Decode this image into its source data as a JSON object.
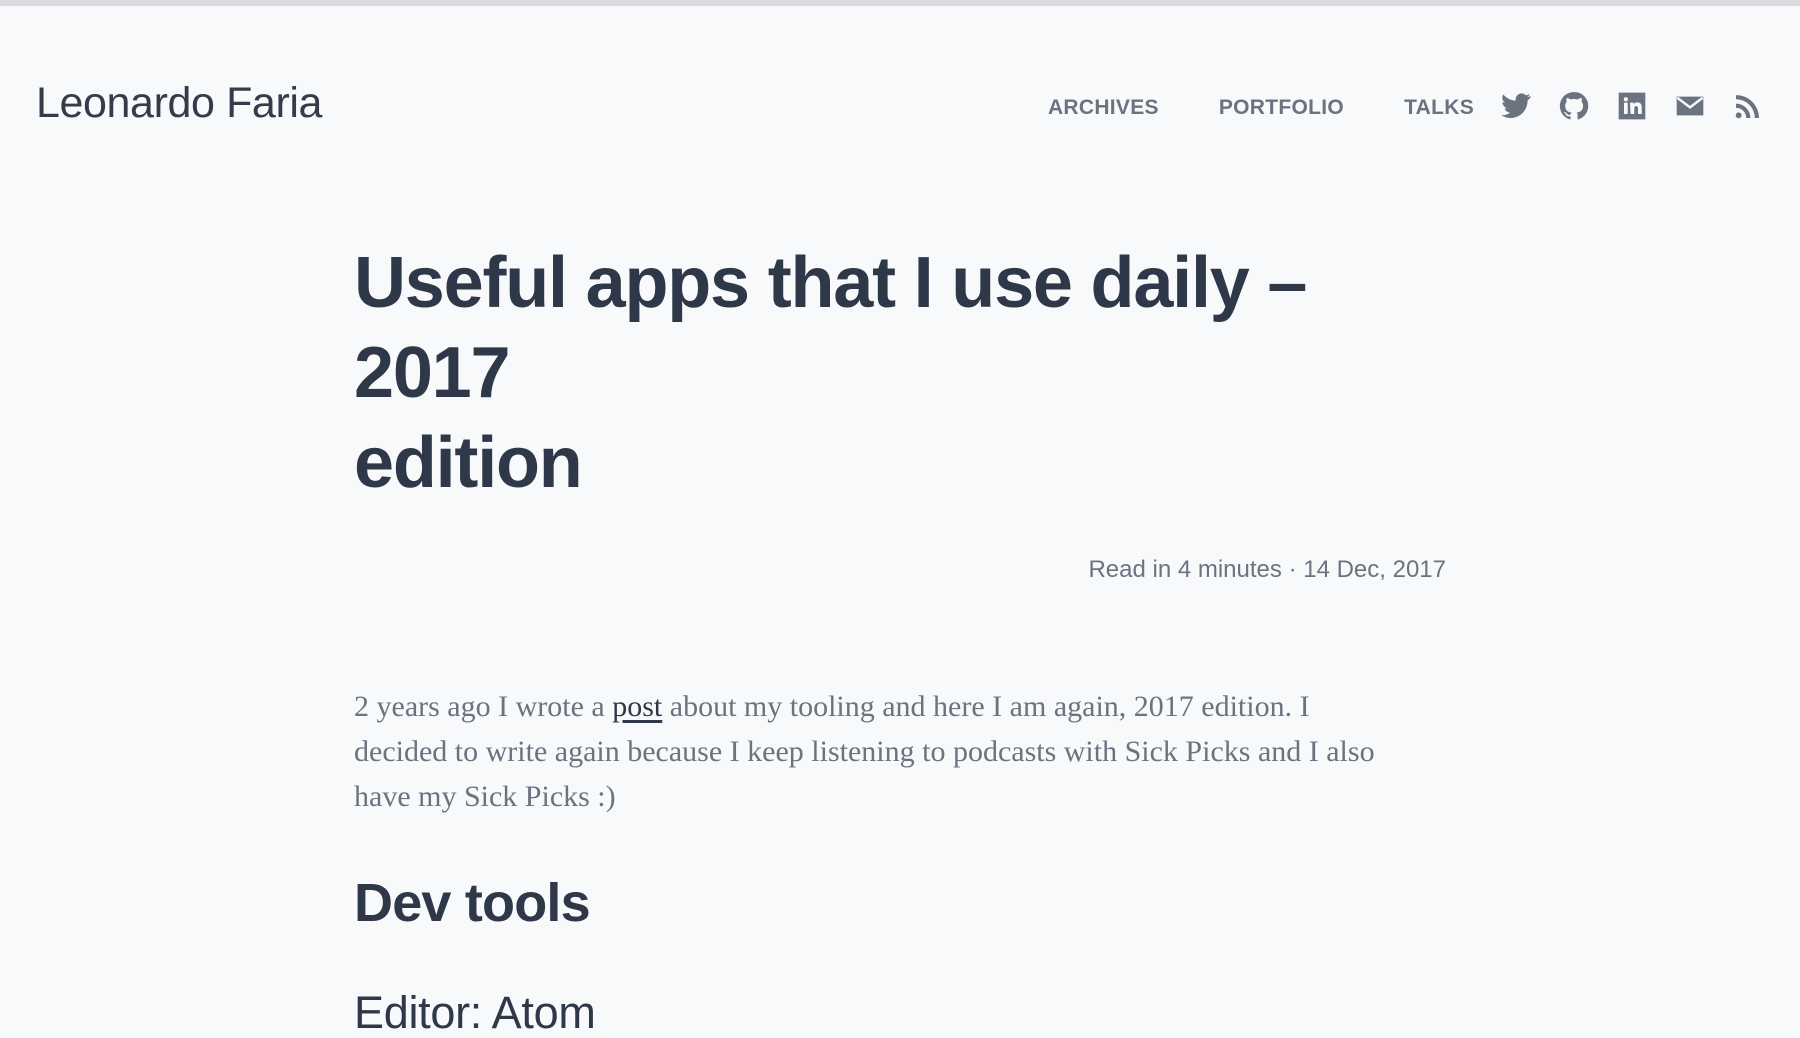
{
  "header": {
    "brand": "Leonardo Faria",
    "nav": [
      {
        "label": "ARCHIVES"
      },
      {
        "label": "PORTFOLIO"
      },
      {
        "label": "TALKS"
      }
    ],
    "social": [
      {
        "icon": "twitter-icon"
      },
      {
        "icon": "github-icon"
      },
      {
        "icon": "linkedin-icon"
      },
      {
        "icon": "email-icon"
      },
      {
        "icon": "rss-icon"
      }
    ]
  },
  "article": {
    "title_line_1": "Useful apps that I use daily – 2017",
    "title_line_2": "edition",
    "meta": "Read in 4 minutes · 14 Dec, 2017",
    "intro_before_link": "2 years ago I wrote a ",
    "intro_link": "post",
    "intro_after_link": " about my tooling and here I am again, 2017 edition. I decided to write again because I keep listening to podcasts with Sick Picks and I also have my Sick Picks :)",
    "section_heading": "Dev tools",
    "subheading": "Editor: Atom"
  },
  "colors": {
    "background": "#f8f9fb",
    "text_primary": "#2f3848",
    "text_secondary": "#6b7280",
    "top_bar": "#d9dbe1"
  }
}
